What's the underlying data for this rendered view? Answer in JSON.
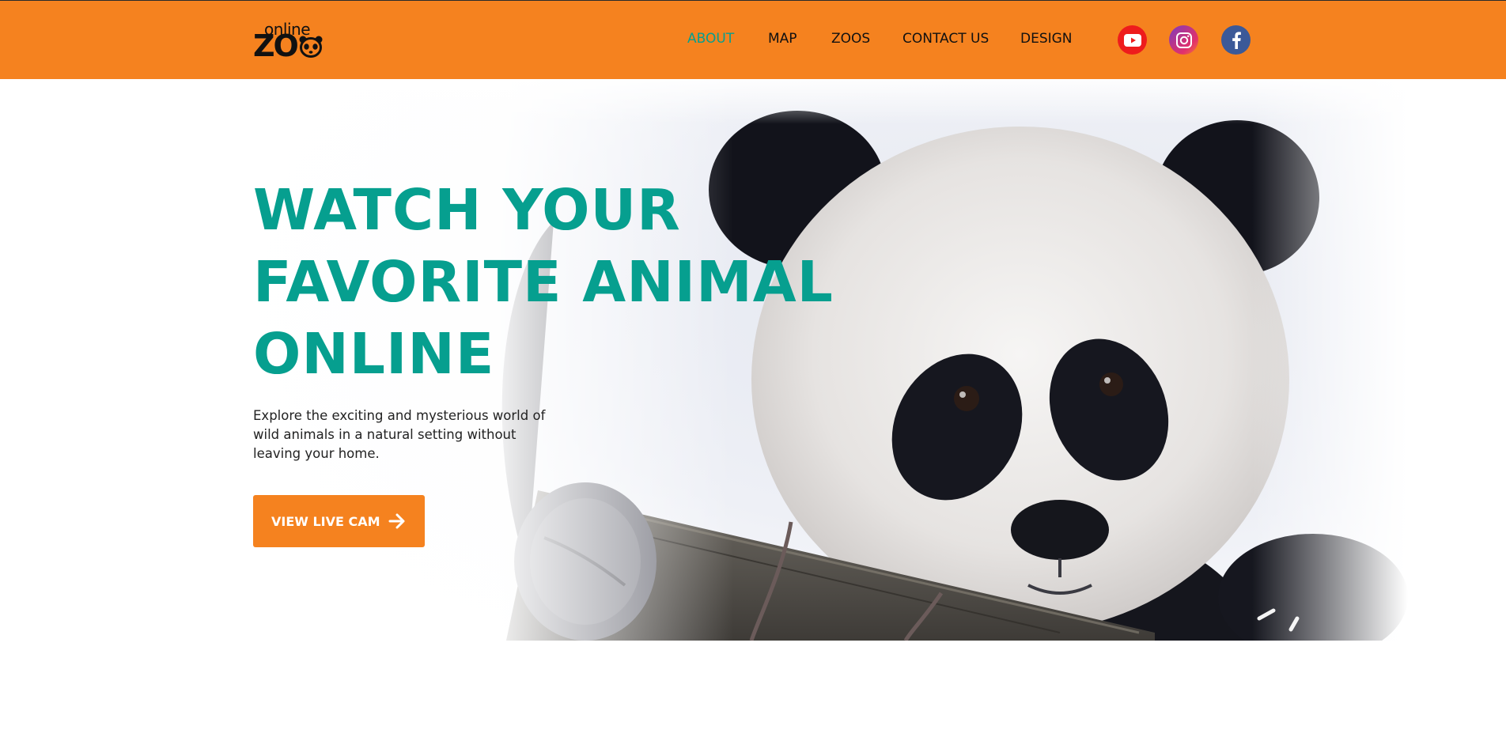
{
  "brand": {
    "logo_small": "online",
    "logo_big": "ZO"
  },
  "nav": {
    "items": [
      {
        "label": "ABOUT",
        "active": true
      },
      {
        "label": "MAP",
        "active": false
      },
      {
        "label": "ZOOS",
        "active": false
      },
      {
        "label": "CONTACT US",
        "active": false
      },
      {
        "label": "DESIGN",
        "active": false
      }
    ]
  },
  "social": [
    {
      "icon": "youtube-icon"
    },
    {
      "icon": "instagram-icon"
    },
    {
      "icon": "facebook-icon"
    }
  ],
  "hero": {
    "title_lines": [
      "WATCH YOUR",
      "FAVORITE ANIMAL",
      "ONLINE"
    ],
    "subtitle": "Explore the exciting and mysterious world of wild animals in a natural setting without leaving your home.",
    "cta_label": "VIEW LIVE CAM",
    "image_icon": "panda-photo"
  },
  "colors": {
    "header_bg": "#f5821f",
    "accent_teal": "#069f8f",
    "button_bg": "#f5821f"
  }
}
